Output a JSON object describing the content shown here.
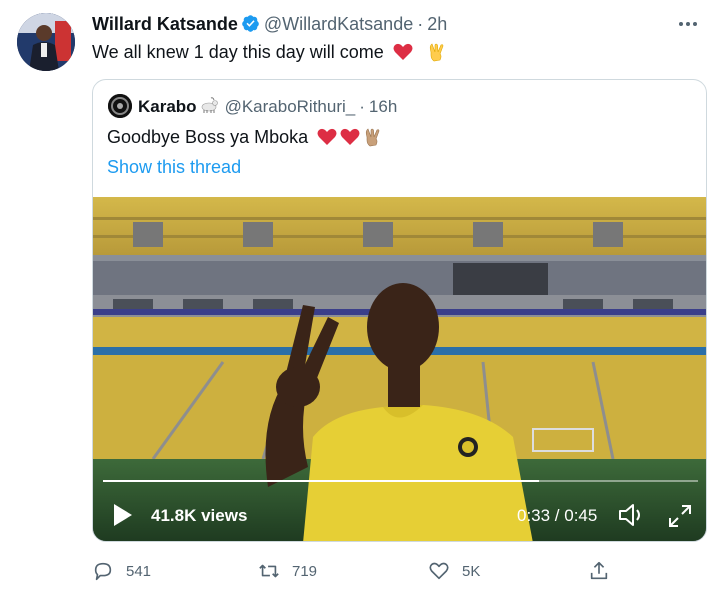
{
  "tweet": {
    "author_name": "Willard Katsande",
    "handle": "@WillardKatsande",
    "separator": "·",
    "time": "2h",
    "text": "We all knew 1 day this day will come"
  },
  "quoted": {
    "author_name": "Karabo",
    "handle": "@KaraboRithuri_",
    "separator": "·",
    "time": "16h",
    "text": "Goodbye Boss ya Mboka",
    "show_thread": "Show this thread"
  },
  "video": {
    "views": "41.8K views",
    "time": "0:33 / 0:45",
    "progress": 0.733
  },
  "actions": {
    "replies": "541",
    "retweets": "719",
    "likes": "5K"
  },
  "colors": {
    "link": "#1d9bf0",
    "heart": "#e0245e",
    "muted": "#536471",
    "stadium_yellow": "#e8c53a"
  },
  "icons": {
    "more": "more-icon",
    "verified": "verified-badge-icon",
    "reply": "reply-icon",
    "retweet": "retweet-icon",
    "like": "like-icon",
    "share": "share-icon",
    "play": "play-icon",
    "volume": "volume-icon",
    "fullscreen": "fullscreen-icon"
  }
}
